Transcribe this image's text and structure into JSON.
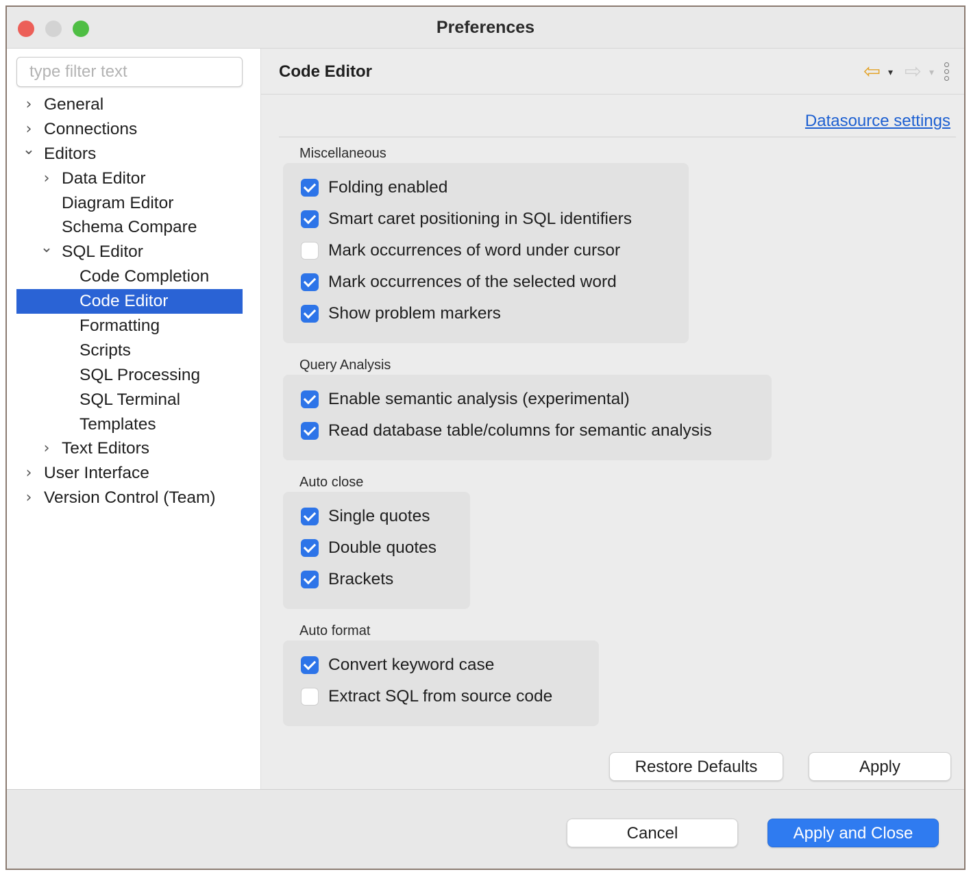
{
  "window": {
    "title": "Preferences"
  },
  "sidebar": {
    "filter_placeholder": "type filter text",
    "items": [
      {
        "label": "General",
        "level": 0,
        "chevron": "collapsed"
      },
      {
        "label": "Connections",
        "level": 0,
        "chevron": "collapsed"
      },
      {
        "label": "Editors",
        "level": 0,
        "chevron": "expanded"
      },
      {
        "label": "Data Editor",
        "level": 1,
        "chevron": "collapsed"
      },
      {
        "label": "Diagram Editor",
        "level": 1,
        "chevron": "none"
      },
      {
        "label": "Schema Compare",
        "level": 1,
        "chevron": "none"
      },
      {
        "label": "SQL Editor",
        "level": 1,
        "chevron": "expanded"
      },
      {
        "label": "Code Completion",
        "level": 2,
        "chevron": "none"
      },
      {
        "label": "Code Editor",
        "level": 2,
        "chevron": "none",
        "selected": true
      },
      {
        "label": "Formatting",
        "level": 2,
        "chevron": "none"
      },
      {
        "label": "Scripts",
        "level": 2,
        "chevron": "none"
      },
      {
        "label": "SQL Processing",
        "level": 2,
        "chevron": "none"
      },
      {
        "label": "SQL Terminal",
        "level": 2,
        "chevron": "none"
      },
      {
        "label": "Templates",
        "level": 2,
        "chevron": "none"
      },
      {
        "label": "Text Editors",
        "level": 1,
        "chevron": "collapsed"
      },
      {
        "label": "User Interface",
        "level": 0,
        "chevron": "collapsed"
      },
      {
        "label": "Version Control (Team)",
        "level": 0,
        "chevron": "collapsed"
      }
    ]
  },
  "content": {
    "title": "Code Editor",
    "datasource_link": "Datasource settings",
    "icons": {
      "back": "back-arrow-icon",
      "forward": "forward-arrow-icon",
      "menu": "view-menu-icon"
    },
    "groups": [
      {
        "title": "Miscellaneous",
        "options": [
          {
            "label": "Folding enabled",
            "checked": true
          },
          {
            "label": "Smart caret positioning in SQL identifiers",
            "checked": true
          },
          {
            "label": "Mark occurrences of word under cursor",
            "checked": false
          },
          {
            "label": "Mark occurrences of the selected word",
            "checked": true
          },
          {
            "label": "Show problem markers",
            "checked": true
          }
        ]
      },
      {
        "title": "Query Analysis",
        "options": [
          {
            "label": "Enable semantic analysis (experimental)",
            "checked": true
          },
          {
            "label": "Read database table/columns for semantic analysis",
            "checked": true
          }
        ]
      },
      {
        "title": "Auto close",
        "options": [
          {
            "label": "Single quotes",
            "checked": true
          },
          {
            "label": "Double quotes",
            "checked": true
          },
          {
            "label": "Brackets",
            "checked": true
          }
        ]
      },
      {
        "title": "Auto format",
        "options": [
          {
            "label": "Convert keyword case",
            "checked": true
          },
          {
            "label": "Extract SQL from source code",
            "checked": false
          }
        ]
      }
    ],
    "restore_defaults_label": "Restore Defaults",
    "apply_label": "Apply"
  },
  "footer": {
    "cancel_label": "Cancel",
    "apply_close_label": "Apply and Close"
  },
  "colors": {
    "selection": "#2a63d5",
    "checkbox_checked": "#2d74e8",
    "link": "#1c5fd1",
    "primary_button": "#2f7bf0",
    "back_arrow": "#e3a32a"
  }
}
